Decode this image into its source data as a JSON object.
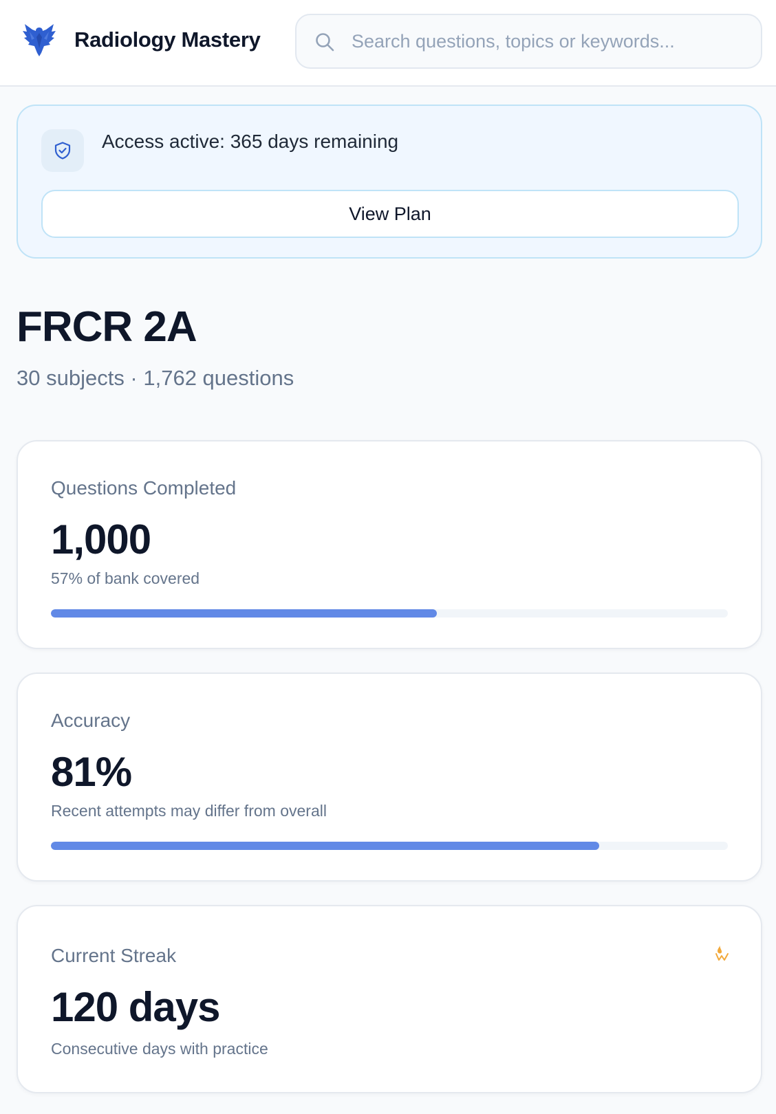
{
  "header": {
    "brand": "Radiology Mastery",
    "logo_icon": "eagle-logo-icon",
    "search": {
      "icon": "search-icon",
      "placeholder": "Search questions, topics or keywords...",
      "value": ""
    }
  },
  "access": {
    "icon": "shield-check-icon",
    "text": "Access active: 365 days remaining",
    "button_label": "View Plan"
  },
  "page": {
    "title": "FRCR 2A",
    "subtitle": "30 subjects · 1,762 questions"
  },
  "stats": [
    {
      "label": "Questions Completed",
      "value": "1,000",
      "note": "57% of bank covered",
      "progress": 0.57
    },
    {
      "label": "Accuracy",
      "value": "81%",
      "note": "Recent attempts may differ from overall",
      "progress": 0.81
    },
    {
      "label": "Current Streak",
      "value": "120 days",
      "note": "Consecutive days with practice",
      "icon": "flame-icon"
    }
  ],
  "colors": {
    "accent": "#6189e6",
    "brand_blue": "#2f5fd0",
    "access_bg": "#f0f7ff",
    "access_border": "#bfe3f7",
    "streak_icon": "#f2a93b"
  }
}
